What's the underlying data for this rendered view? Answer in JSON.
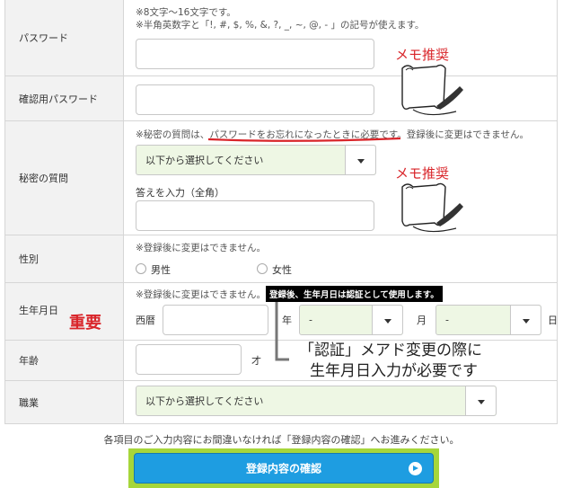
{
  "password": {
    "label": "パスワード",
    "note1": "※8文字～16文字です。",
    "note2": "※半角英数字と「!, #, $, %, &, ?, _, ~, @, - 」の記号が使えます。",
    "value": ""
  },
  "memo1": "メモ推奨",
  "confirm_password": {
    "label": "確認用パスワード",
    "value": ""
  },
  "secret": {
    "label": "秘密の質問",
    "note_prefix": "※秘密の質問は、",
    "note_underlined": "パスワードをお忘れになったときに必要",
    "note_suffix": "です。登録後に変更はできません。",
    "select_value": "以下から選択してください",
    "answer_label": "答えを入力（全角）",
    "answer_value": ""
  },
  "memo2": "メモ推奨",
  "gender": {
    "label": "性別",
    "note": "※登録後に変更はできません。",
    "male": "男性",
    "female": "女性"
  },
  "birthdate": {
    "label": "生年月日",
    "note": "※登録後に変更はできません。",
    "badge": "登録後、生年月日は認証として使用します。",
    "era_label": "西暦",
    "year_unit": "年",
    "month_value": "-",
    "month_unit": "月",
    "day_value": "-",
    "day_unit": "日"
  },
  "important": "重要",
  "callout_line1": "「認証」メアド変更の際に",
  "callout_line2": "生年月日入力が必要です",
  "age": {
    "label": "年齢",
    "unit": "才",
    "value": ""
  },
  "occupation": {
    "label": "職業",
    "select_value": "以下から選択してください"
  },
  "footer_note": "各項目のご入力内容にお間違いなければ「登録内容の確認」へお進みください。",
  "submit_label": "登録内容の確認",
  "colors": {
    "accent_red": "#d9252a",
    "button_blue": "#1e9de1",
    "highlight_green": "#a6d63a"
  }
}
